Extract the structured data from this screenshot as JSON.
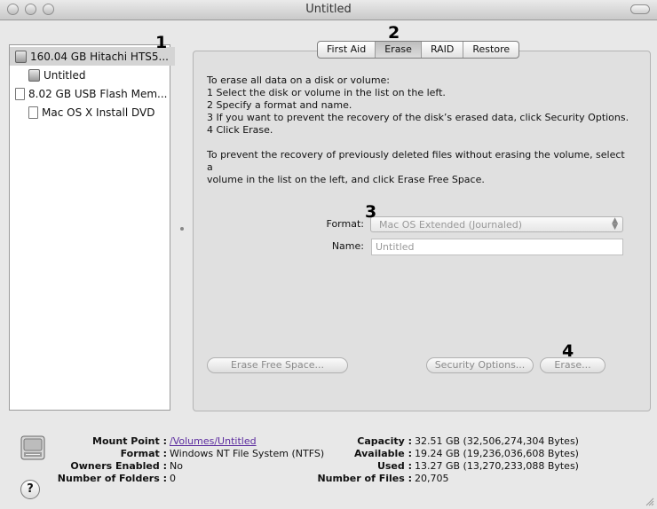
{
  "window": {
    "title": "Untitled"
  },
  "sidebar": {
    "items": [
      {
        "label": "160.04 GB Hitachi HTS5...",
        "icon": "hard-drive-icon",
        "selected": true
      },
      {
        "label": "Untitled",
        "icon": "volume-icon",
        "selected": false
      },
      {
        "label": "8.02 GB USB Flash Mem...",
        "icon": "usb-drive-icon",
        "selected": false
      },
      {
        "label": "Mac OS X Install DVD",
        "icon": "volume-icon",
        "selected": false
      }
    ]
  },
  "tabs": [
    {
      "label": "First Aid",
      "active": false
    },
    {
      "label": "Erase",
      "active": true
    },
    {
      "label": "RAID",
      "active": false
    },
    {
      "label": "Restore",
      "active": false
    }
  ],
  "instructions": {
    "lines": [
      "To erase all data on a disk or volume:",
      "1 Select the disk or volume in the list on the left.",
      "2 Specify a format and name.",
      "3 If you want to prevent the recovery of the disk’s erased data, click Security Options.",
      "4 Click Erase."
    ],
    "para2_line1": "To prevent the recovery of previously deleted files without erasing the volume, select a",
    "para2_line2": "volume in the list on the left, and click Erase Free Space."
  },
  "form": {
    "format_label": "Format:",
    "format_value": "Mac OS Extended (Journaled)",
    "name_label": "Name:",
    "name_value": "Untitled"
  },
  "buttons": {
    "erase_free_space": "Erase Free Space...",
    "security_options": "Security Options...",
    "erase": "Erase..."
  },
  "callouts": [
    "1",
    "2",
    "3",
    "4"
  ],
  "info": {
    "mount_point_label": "Mount Point :",
    "mount_point_value": "/Volumes/Untitled",
    "format_label": "Format :",
    "format_value": "Windows NT File System (NTFS)",
    "owners_label": "Owners Enabled :",
    "owners_value": "No",
    "folders_label": "Number of Folders :",
    "folders_value": "0",
    "capacity_label": "Capacity :",
    "capacity_value": "32.51 GB (32,506,274,304 Bytes)",
    "available_label": "Available :",
    "available_value": "19.24 GB (19,236,036,608 Bytes)",
    "used_label": "Used :",
    "used_value": "13.27 GB (13,270,233,088 Bytes)",
    "files_label": "Number of Files :",
    "files_value": "20,705"
  },
  "help": {
    "symbol": "?"
  }
}
